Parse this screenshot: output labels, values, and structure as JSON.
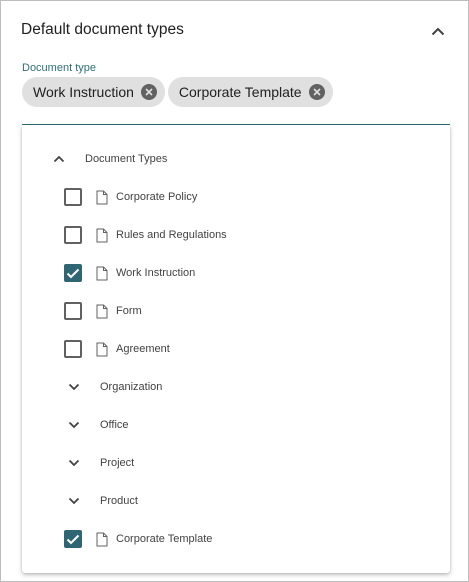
{
  "panel": {
    "title": "Default document types",
    "collapse_icon": "chevron-up-icon"
  },
  "field": {
    "label": "Document type",
    "chips": [
      {
        "label": "Work Instruction",
        "remove_icon": "cancel-circle-icon"
      },
      {
        "label": "Corporate Template",
        "remove_icon": "cancel-circle-icon"
      }
    ]
  },
  "tree": {
    "root": {
      "label": "Document Types",
      "expanded": true,
      "icon": "chevron-up-icon"
    },
    "items": [
      {
        "label": "Corporate Policy",
        "checked": false,
        "icon": "document-icon"
      },
      {
        "label": "Rules and Regulations",
        "checked": false,
        "icon": "document-icon"
      },
      {
        "label": "Work Instruction",
        "checked": true,
        "icon": "document-icon"
      },
      {
        "label": "Form",
        "checked": false,
        "icon": "document-icon"
      },
      {
        "label": "Agreement",
        "checked": false,
        "icon": "document-icon"
      }
    ],
    "groups": [
      {
        "label": "Organization",
        "expanded": false,
        "icon": "chevron-down-icon"
      },
      {
        "label": "Office",
        "expanded": false,
        "icon": "chevron-down-icon"
      },
      {
        "label": "Project",
        "expanded": false,
        "icon": "chevron-down-icon"
      },
      {
        "label": "Product",
        "expanded": false,
        "icon": "chevron-down-icon"
      }
    ],
    "bottom_item": {
      "label": "Corporate Template",
      "checked": true,
      "icon": "document-icon"
    }
  },
  "colors": {
    "accent": "#2e6674",
    "label_accent": "#2e6f7a",
    "chip_bg": "#e0e0e0"
  }
}
